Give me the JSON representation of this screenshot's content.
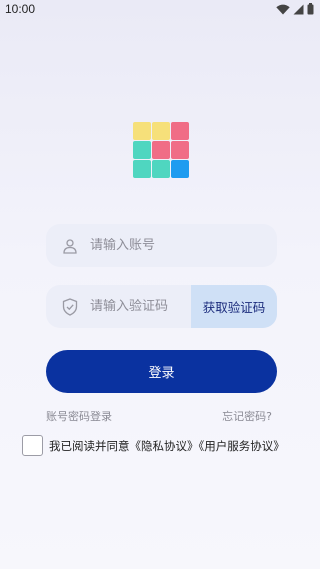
{
  "status": {
    "time": "10:00"
  },
  "logo": {
    "tiles": [
      "#f6e07a",
      "#f6e07a",
      "#f06d86",
      "#4fd6c0",
      "#f06d86",
      "#f06d86",
      "#4fd6c0",
      "#4fd6c0",
      "#1e9cf0"
    ]
  },
  "account": {
    "placeholder": "请输入账号",
    "icon": "user-icon"
  },
  "code": {
    "placeholder": "请输入验证码",
    "icon": "shield-icon",
    "get_code_label": "获取验证码"
  },
  "login": {
    "label": "登录"
  },
  "links": {
    "password_login": "账号密码登录",
    "forgot_password": "忘记密码?"
  },
  "agreement": {
    "prefix": "我已阅读并同意",
    "privacy": "《隐私协议》",
    "service": "《用户服务协议》"
  },
  "colors": {
    "primary": "#0a32a0",
    "get_code_bg": "#cfe0f6",
    "field_bg": "#eceef8"
  }
}
